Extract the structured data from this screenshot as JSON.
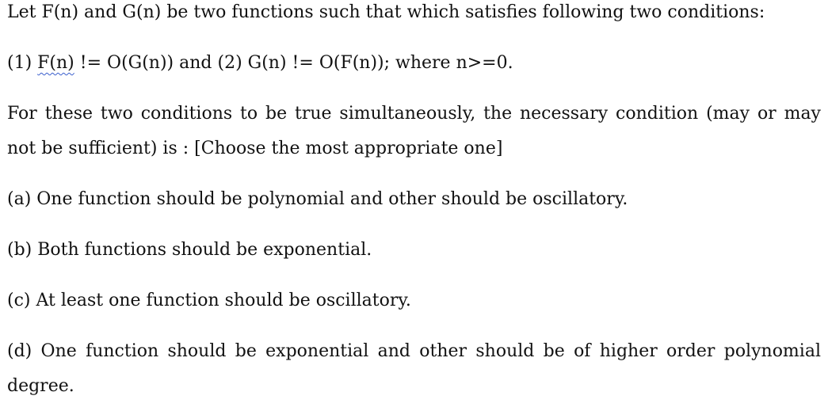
{
  "question": {
    "intro": "Let F(n) and G(n) be two functions such that which satisfies following two conditions:",
    "conditions": {
      "prefix": "(1) ",
      "marked": "F(n)",
      "rest": " != O(G(n)) and (2) G(n) != O(F(n)); where n>=0."
    },
    "prompt": "For these two conditions to be true simultaneously, the necessary condition (may or may not be sufficient) is : [Choose the most appropriate one]"
  },
  "options": [
    "(a) One function should be polynomial and other should be oscillatory.",
    "(b) Both functions should be exponential.",
    "(c) At least one function should be oscillatory.",
    "(d) One function should be exponential and other should be of higher order polynomial degree."
  ]
}
